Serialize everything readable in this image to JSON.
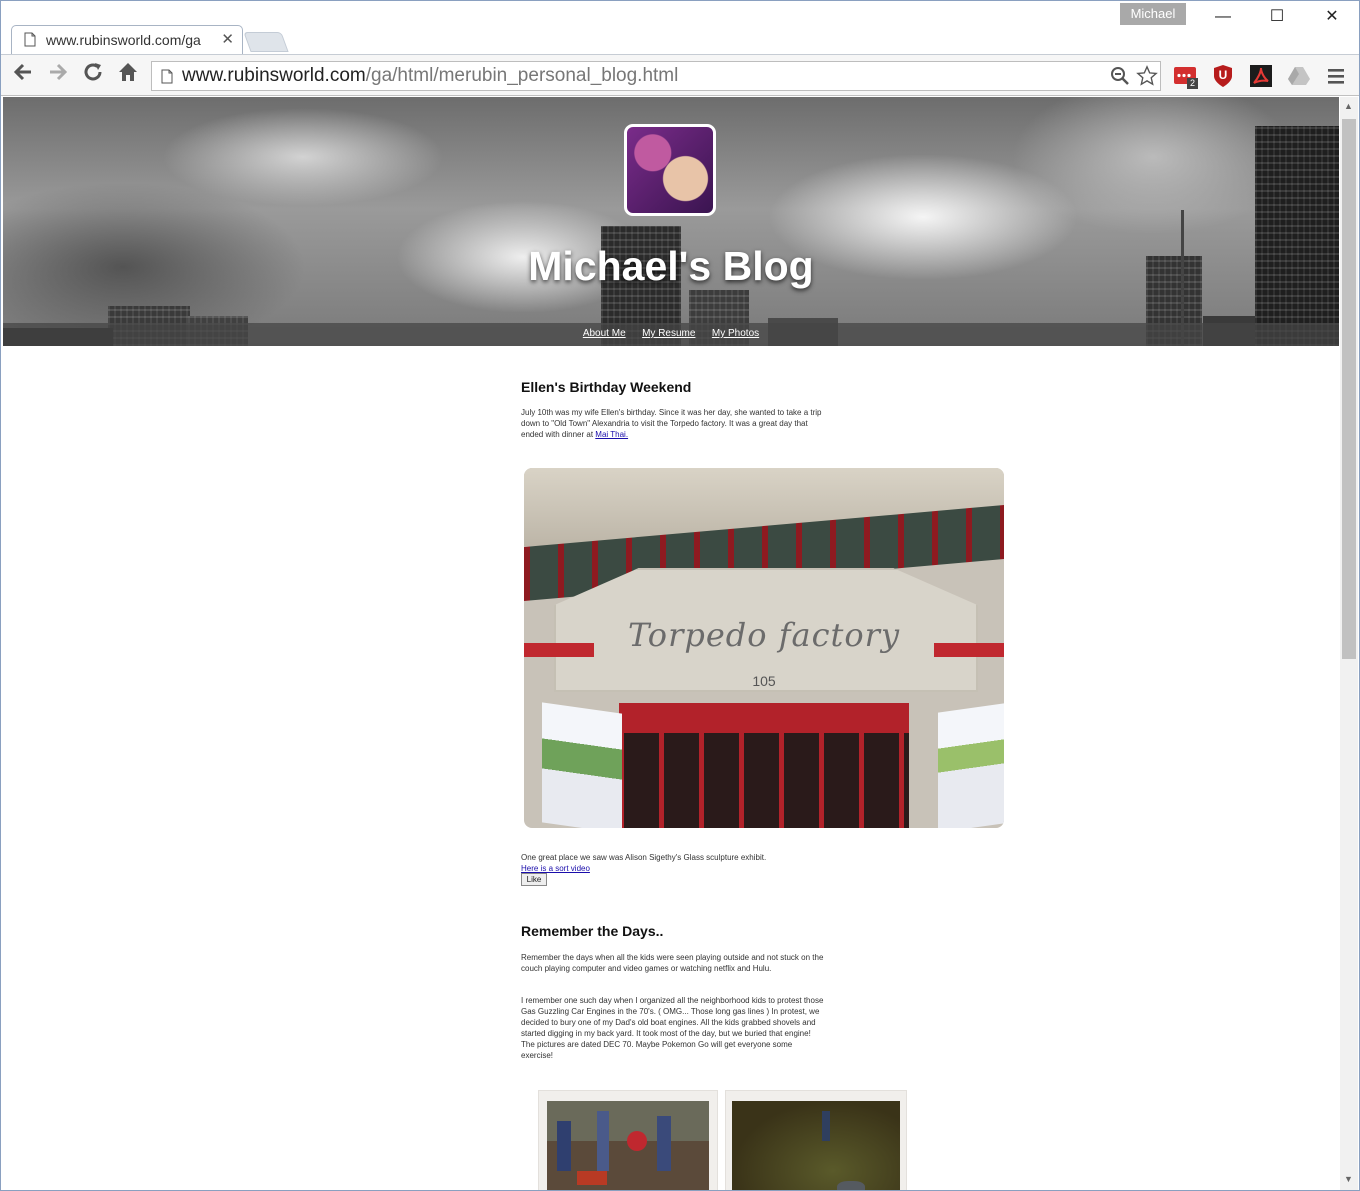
{
  "browser": {
    "tab_title": "www.rubinsworld.com/ga",
    "profile_name": "Michael",
    "url_host": "www.rubinsworld.com",
    "url_path": "/ga/html/merubin_personal_blog.html",
    "ext_badge_count": "2",
    "ext_u_letter": "U"
  },
  "header": {
    "title": "Michael's Blog",
    "nav": [
      "About Me",
      "My Resume",
      "My Photos"
    ]
  },
  "posts": [
    {
      "title": "Ellen's Birthday Weekend",
      "intro": "July 10th was my wife Ellen's birthday. Since it was her day, she wanted to take a trip down to \"Old Town\" Alexandria to visit the Torpedo factory. It was a great day that ended with dinner at",
      "intro_link": "Mai Thai.",
      "photo_sign": "Torpedo factory",
      "photo_number": "105",
      "caption": "One great place we saw was Alison Sigethy's Glass sculpture exhibit.",
      "video_link": "Here is a sort video",
      "like_label": "Like"
    },
    {
      "title": "Remember the Days..",
      "para1": "Remember the days when all the kids were seen playing outside and not stuck on the couch playing computer and video games or watching netflix and Hulu.",
      "para2": "I remember one such day when I organized all the neighborhood kids to protest those Gas Guzzling Car Engines in the 70's. ( OMG... Those long gas lines ) In protest, we decided to bury one of my Dad's old boat engines. All the kids grabbed shovels and started digging in my back yard. It took most of the day, but we buried that engine! The pictures are dated DEC 70. Maybe Pokemon Go will get everyone some exercise!"
    }
  ],
  "colors": {
    "link": "#1a0dab",
    "ext_red": "#d32f2f",
    "ublock_red": "#b71c1c"
  }
}
